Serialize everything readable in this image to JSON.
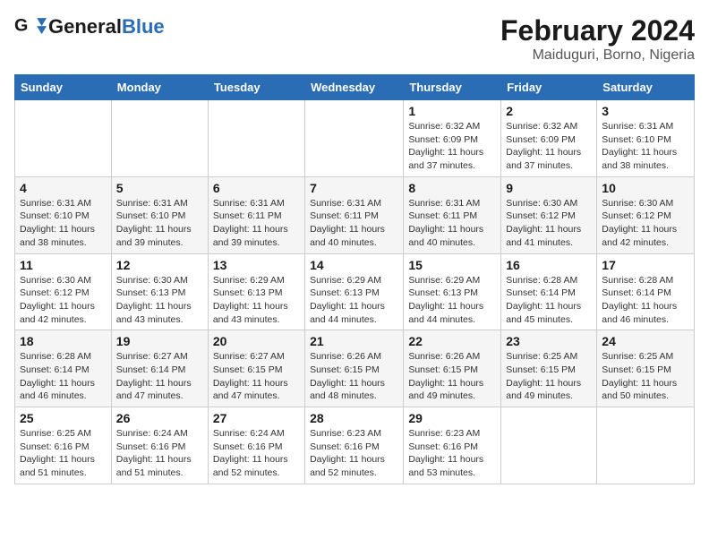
{
  "header": {
    "logo_general": "General",
    "logo_blue": "Blue",
    "month_title": "February 2024",
    "location": "Maiduguri, Borno, Nigeria"
  },
  "days_of_week": [
    "Sunday",
    "Monday",
    "Tuesday",
    "Wednesday",
    "Thursday",
    "Friday",
    "Saturday"
  ],
  "weeks": [
    [
      {
        "day": "",
        "info": ""
      },
      {
        "day": "",
        "info": ""
      },
      {
        "day": "",
        "info": ""
      },
      {
        "day": "",
        "info": ""
      },
      {
        "day": "1",
        "info": "Sunrise: 6:32 AM\nSunset: 6:09 PM\nDaylight: 11 hours and 37 minutes."
      },
      {
        "day": "2",
        "info": "Sunrise: 6:32 AM\nSunset: 6:09 PM\nDaylight: 11 hours and 37 minutes."
      },
      {
        "day": "3",
        "info": "Sunrise: 6:31 AM\nSunset: 6:10 PM\nDaylight: 11 hours and 38 minutes."
      }
    ],
    [
      {
        "day": "4",
        "info": "Sunrise: 6:31 AM\nSunset: 6:10 PM\nDaylight: 11 hours and 38 minutes."
      },
      {
        "day": "5",
        "info": "Sunrise: 6:31 AM\nSunset: 6:10 PM\nDaylight: 11 hours and 39 minutes."
      },
      {
        "day": "6",
        "info": "Sunrise: 6:31 AM\nSunset: 6:11 PM\nDaylight: 11 hours and 39 minutes."
      },
      {
        "day": "7",
        "info": "Sunrise: 6:31 AM\nSunset: 6:11 PM\nDaylight: 11 hours and 40 minutes."
      },
      {
        "day": "8",
        "info": "Sunrise: 6:31 AM\nSunset: 6:11 PM\nDaylight: 11 hours and 40 minutes."
      },
      {
        "day": "9",
        "info": "Sunrise: 6:30 AM\nSunset: 6:12 PM\nDaylight: 11 hours and 41 minutes."
      },
      {
        "day": "10",
        "info": "Sunrise: 6:30 AM\nSunset: 6:12 PM\nDaylight: 11 hours and 42 minutes."
      }
    ],
    [
      {
        "day": "11",
        "info": "Sunrise: 6:30 AM\nSunset: 6:12 PM\nDaylight: 11 hours and 42 minutes."
      },
      {
        "day": "12",
        "info": "Sunrise: 6:30 AM\nSunset: 6:13 PM\nDaylight: 11 hours and 43 minutes."
      },
      {
        "day": "13",
        "info": "Sunrise: 6:29 AM\nSunset: 6:13 PM\nDaylight: 11 hours and 43 minutes."
      },
      {
        "day": "14",
        "info": "Sunrise: 6:29 AM\nSunset: 6:13 PM\nDaylight: 11 hours and 44 minutes."
      },
      {
        "day": "15",
        "info": "Sunrise: 6:29 AM\nSunset: 6:13 PM\nDaylight: 11 hours and 44 minutes."
      },
      {
        "day": "16",
        "info": "Sunrise: 6:28 AM\nSunset: 6:14 PM\nDaylight: 11 hours and 45 minutes."
      },
      {
        "day": "17",
        "info": "Sunrise: 6:28 AM\nSunset: 6:14 PM\nDaylight: 11 hours and 46 minutes."
      }
    ],
    [
      {
        "day": "18",
        "info": "Sunrise: 6:28 AM\nSunset: 6:14 PM\nDaylight: 11 hours and 46 minutes."
      },
      {
        "day": "19",
        "info": "Sunrise: 6:27 AM\nSunset: 6:14 PM\nDaylight: 11 hours and 47 minutes."
      },
      {
        "day": "20",
        "info": "Sunrise: 6:27 AM\nSunset: 6:15 PM\nDaylight: 11 hours and 47 minutes."
      },
      {
        "day": "21",
        "info": "Sunrise: 6:26 AM\nSunset: 6:15 PM\nDaylight: 11 hours and 48 minutes."
      },
      {
        "day": "22",
        "info": "Sunrise: 6:26 AM\nSunset: 6:15 PM\nDaylight: 11 hours and 49 minutes."
      },
      {
        "day": "23",
        "info": "Sunrise: 6:25 AM\nSunset: 6:15 PM\nDaylight: 11 hours and 49 minutes."
      },
      {
        "day": "24",
        "info": "Sunrise: 6:25 AM\nSunset: 6:15 PM\nDaylight: 11 hours and 50 minutes."
      }
    ],
    [
      {
        "day": "25",
        "info": "Sunrise: 6:25 AM\nSunset: 6:16 PM\nDaylight: 11 hours and 51 minutes."
      },
      {
        "day": "26",
        "info": "Sunrise: 6:24 AM\nSunset: 6:16 PM\nDaylight: 11 hours and 51 minutes."
      },
      {
        "day": "27",
        "info": "Sunrise: 6:24 AM\nSunset: 6:16 PM\nDaylight: 11 hours and 52 minutes."
      },
      {
        "day": "28",
        "info": "Sunrise: 6:23 AM\nSunset: 6:16 PM\nDaylight: 11 hours and 52 minutes."
      },
      {
        "day": "29",
        "info": "Sunrise: 6:23 AM\nSunset: 6:16 PM\nDaylight: 11 hours and 53 minutes."
      },
      {
        "day": "",
        "info": ""
      },
      {
        "day": "",
        "info": ""
      }
    ]
  ]
}
